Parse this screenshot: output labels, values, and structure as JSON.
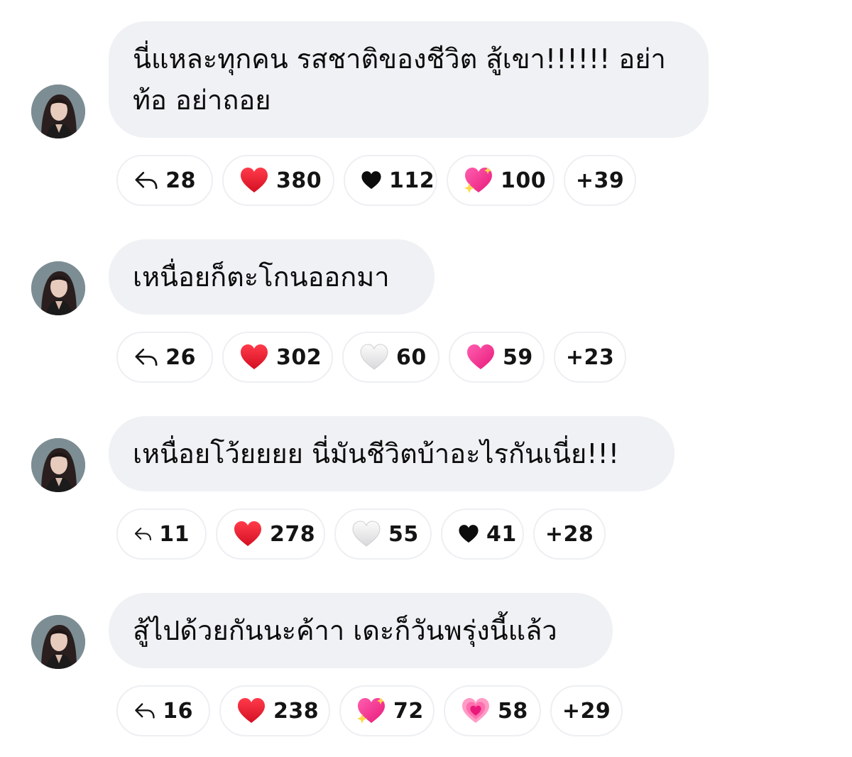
{
  "comments": [
    {
      "text": "นี่แหละทุกคน รสชาติของชีวิต สู้เขา!!!!!! อย่าท้อ อย่าถอย",
      "replies": "28",
      "reactions": [
        {
          "icon": "red-heart-icon",
          "count": "380"
        },
        {
          "icon": "black-heart-icon",
          "count": "112"
        },
        {
          "icon": "sparkling-heart-icon",
          "count": "100"
        }
      ],
      "more": "+39"
    },
    {
      "text": "เหนื่อยก็ตะโกนออกมา",
      "replies": "26",
      "reactions": [
        {
          "icon": "red-heart-icon",
          "count": "302"
        },
        {
          "icon": "white-heart-icon",
          "count": "60"
        },
        {
          "icon": "pink-heart-icon",
          "count": "59"
        }
      ],
      "more": "+23"
    },
    {
      "text": "เหนื่อยโว้ยยยย นี่มันชีวิตบ้าอะไรกันเนี่ย!!!",
      "replies": "11",
      "reactions": [
        {
          "icon": "red-heart-icon",
          "count": "278"
        },
        {
          "icon": "white-heart-icon",
          "count": "55"
        },
        {
          "icon": "black-heart-icon",
          "count": "41"
        }
      ],
      "more": "+28"
    },
    {
      "text": "สู้ไปด้วยกันนะค้าา เดะก็วันพรุ่งนี้แล้ว",
      "replies": "16",
      "reactions": [
        {
          "icon": "red-heart-icon",
          "count": "238"
        },
        {
          "icon": "sparkling-heart-icon",
          "count": "72"
        },
        {
          "icon": "beating-heart-icon",
          "count": "58"
        }
      ],
      "more": "+29"
    }
  ],
  "colors": {
    "bubble_bg": "#eff1f4",
    "pill_border": "#edeff2",
    "red_heart": "#e0142b",
    "pink_heart": "#f0287a"
  }
}
